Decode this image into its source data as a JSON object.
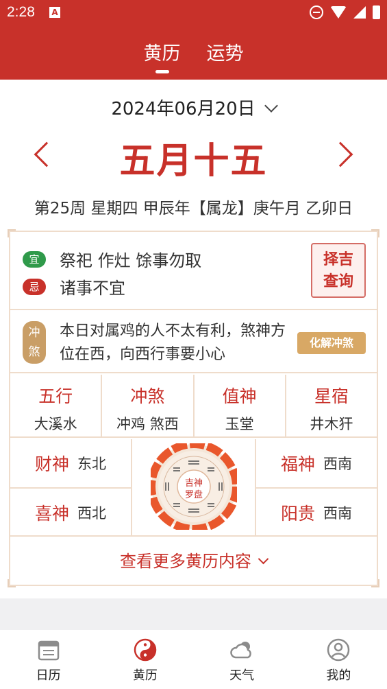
{
  "status": {
    "time": "2:28",
    "a_icon": "A"
  },
  "header": {
    "tabs": [
      {
        "label": "黄历",
        "active": true
      },
      {
        "label": "运势",
        "active": false
      }
    ]
  },
  "date": {
    "solar": "2024年06月20日",
    "lunar": "五月十五",
    "ganzhi": "第25周 星期四 甲辰年【属龙】庚午月 乙卯日"
  },
  "yiji": {
    "yi_badge": "宜",
    "yi_text": "祭祀 作灶 馀事勿取",
    "ji_badge": "忌",
    "ji_text": "诸事不宜",
    "zeji_line1": "择吉",
    "zeji_line2": "查询"
  },
  "chong": {
    "badge_line1": "冲",
    "badge_line2": "煞",
    "text": "本日对属鸡的人不太有利，煞神方位在西，向西行事要小心",
    "huajie_button": "化解冲煞"
  },
  "grid": [
    {
      "title": "五行",
      "value": "大溪水"
    },
    {
      "title": "冲煞",
      "value": "冲鸡 煞西"
    },
    {
      "title": "值神",
      "value": "玉堂"
    },
    {
      "title": "星宿",
      "value": "井木犴"
    }
  ],
  "gods": {
    "caishen": {
      "title": "财神",
      "value": "东北"
    },
    "xishen": {
      "title": "喜神",
      "value": "西北"
    },
    "fushen": {
      "title": "福神",
      "value": "西南"
    },
    "yanggui": {
      "title": "阳贵",
      "value": "西南"
    },
    "compass_center_1": "吉神",
    "compass_center_2": "罗盘"
  },
  "more_label": "查看更多黄历内容",
  "bottom_nav": [
    {
      "label": "日历",
      "icon": "calendar-icon"
    },
    {
      "label": "黄历",
      "icon": "yin-yang-icon",
      "active": true
    },
    {
      "label": "天气",
      "icon": "cloud-icon"
    },
    {
      "label": "我的",
      "icon": "user-icon"
    }
  ],
  "colors": {
    "brand": "#c8312a",
    "gold": "#d8a865",
    "yi_green": "#2f9a4a"
  }
}
